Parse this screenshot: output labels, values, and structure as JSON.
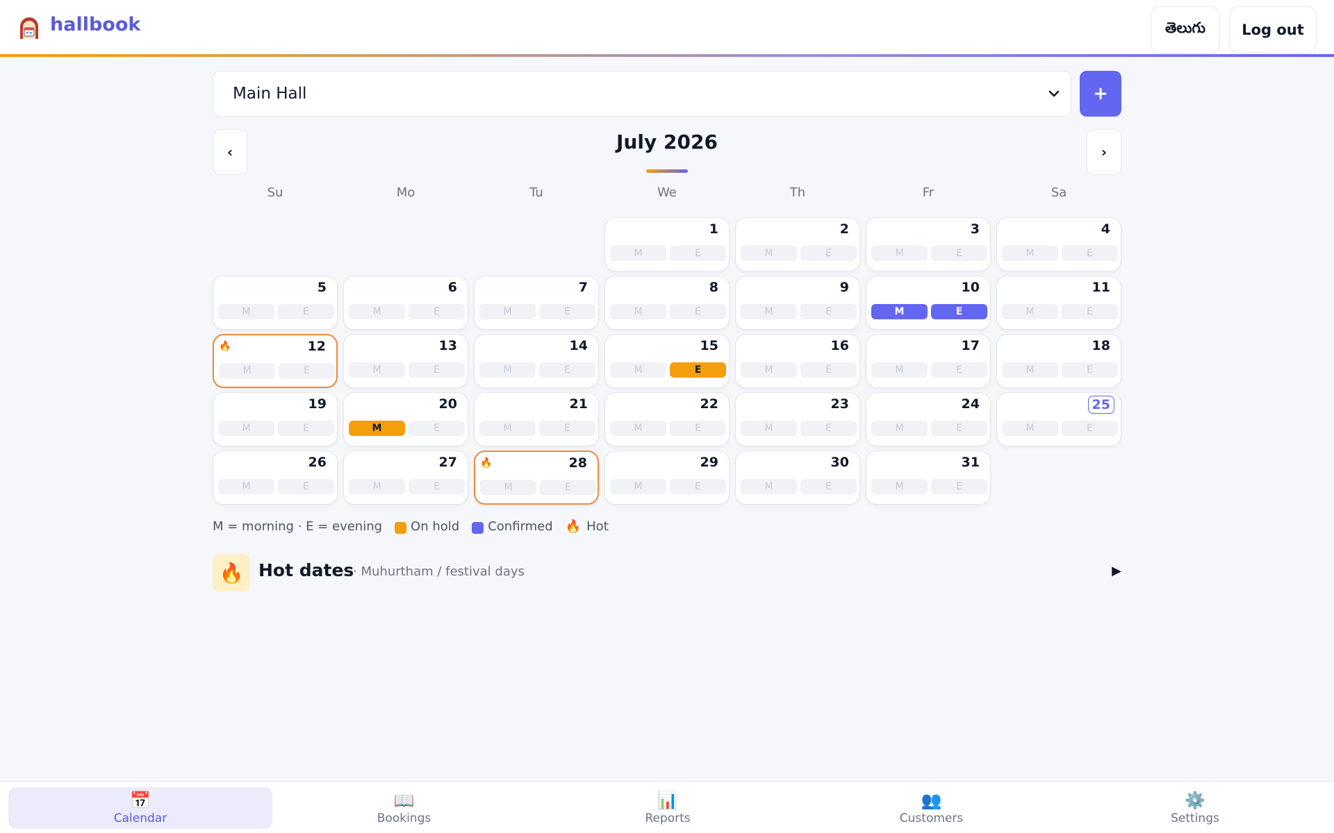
{
  "app": {
    "brand": "hallbook"
  },
  "header": {
    "language_label": "తెలుగు",
    "logout_label": "Log out"
  },
  "hall_select": {
    "value": "Main Hall"
  },
  "add_button": {
    "label": "+"
  },
  "calendar": {
    "month_title": "July 2026",
    "prev_label": "‹",
    "next_label": "›",
    "weekdays": [
      "Su",
      "Mo",
      "Tu",
      "We",
      "Th",
      "Fr",
      "Sa"
    ],
    "first_weekday": 3,
    "days_in_month": 31,
    "today": 25,
    "slot_labels": {
      "morning": "M",
      "evening": "E"
    },
    "hot_days": [
      12,
      28
    ],
    "bookings": [
      {
        "day": 10,
        "slot": "M",
        "status": "confirmed"
      },
      {
        "day": 10,
        "slot": "E",
        "status": "confirmed"
      },
      {
        "day": 15,
        "slot": "E",
        "status": "hold"
      },
      {
        "day": 20,
        "slot": "M",
        "status": "hold"
      }
    ]
  },
  "legend": {
    "slots_text": "M = morning · E = evening",
    "on_hold": "On hold",
    "confirmed": "Confirmed",
    "hot": "Hot"
  },
  "hot_dates": {
    "title": "Hot dates",
    "subtitle": "· Muhurtham / festival days",
    "toggle": "▶"
  },
  "bottom_nav": [
    {
      "label": "Calendar",
      "icon": "calendar-icon",
      "glyph": "📅",
      "active": true
    },
    {
      "label": "Bookings",
      "icon": "book-icon",
      "glyph": "📖",
      "active": false
    },
    {
      "label": "Reports",
      "icon": "bar-chart-icon",
      "glyph": "📊",
      "active": false
    },
    {
      "label": "Customers",
      "icon": "people-icon",
      "glyph": "👥",
      "active": false
    },
    {
      "label": "Settings",
      "icon": "gear-icon",
      "glyph": "⚙️",
      "active": false
    }
  ],
  "colors": {
    "accent": "#6366f1",
    "hold": "#f59e0b",
    "hot_border": "#f08a3c",
    "empty_slot": "#f0f2f6"
  }
}
